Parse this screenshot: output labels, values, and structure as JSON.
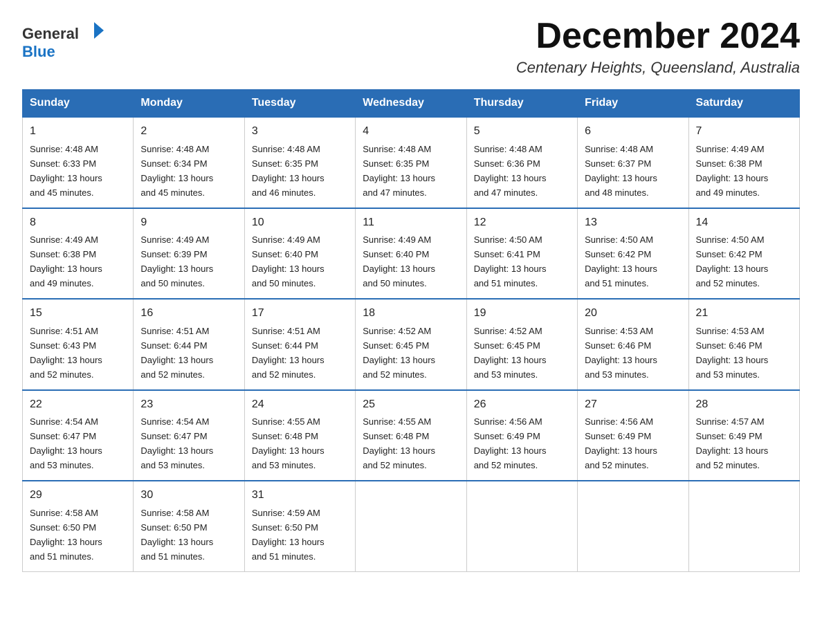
{
  "logo": {
    "text_general": "General",
    "text_blue": "Blue"
  },
  "title": "December 2024",
  "subtitle": "Centenary Heights, Queensland, Australia",
  "weekdays": [
    "Sunday",
    "Monday",
    "Tuesday",
    "Wednesday",
    "Thursday",
    "Friday",
    "Saturday"
  ],
  "weeks": [
    [
      {
        "day": "1",
        "sunrise": "4:48 AM",
        "sunset": "6:33 PM",
        "daylight": "13 hours and 45 minutes."
      },
      {
        "day": "2",
        "sunrise": "4:48 AM",
        "sunset": "6:34 PM",
        "daylight": "13 hours and 45 minutes."
      },
      {
        "day": "3",
        "sunrise": "4:48 AM",
        "sunset": "6:35 PM",
        "daylight": "13 hours and 46 minutes."
      },
      {
        "day": "4",
        "sunrise": "4:48 AM",
        "sunset": "6:35 PM",
        "daylight": "13 hours and 47 minutes."
      },
      {
        "day": "5",
        "sunrise": "4:48 AM",
        "sunset": "6:36 PM",
        "daylight": "13 hours and 47 minutes."
      },
      {
        "day": "6",
        "sunrise": "4:48 AM",
        "sunset": "6:37 PM",
        "daylight": "13 hours and 48 minutes."
      },
      {
        "day": "7",
        "sunrise": "4:49 AM",
        "sunset": "6:38 PM",
        "daylight": "13 hours and 49 minutes."
      }
    ],
    [
      {
        "day": "8",
        "sunrise": "4:49 AM",
        "sunset": "6:38 PM",
        "daylight": "13 hours and 49 minutes."
      },
      {
        "day": "9",
        "sunrise": "4:49 AM",
        "sunset": "6:39 PM",
        "daylight": "13 hours and 50 minutes."
      },
      {
        "day": "10",
        "sunrise": "4:49 AM",
        "sunset": "6:40 PM",
        "daylight": "13 hours and 50 minutes."
      },
      {
        "day": "11",
        "sunrise": "4:49 AM",
        "sunset": "6:40 PM",
        "daylight": "13 hours and 50 minutes."
      },
      {
        "day": "12",
        "sunrise": "4:50 AM",
        "sunset": "6:41 PM",
        "daylight": "13 hours and 51 minutes."
      },
      {
        "day": "13",
        "sunrise": "4:50 AM",
        "sunset": "6:42 PM",
        "daylight": "13 hours and 51 minutes."
      },
      {
        "day": "14",
        "sunrise": "4:50 AM",
        "sunset": "6:42 PM",
        "daylight": "13 hours and 52 minutes."
      }
    ],
    [
      {
        "day": "15",
        "sunrise": "4:51 AM",
        "sunset": "6:43 PM",
        "daylight": "13 hours and 52 minutes."
      },
      {
        "day": "16",
        "sunrise": "4:51 AM",
        "sunset": "6:44 PM",
        "daylight": "13 hours and 52 minutes."
      },
      {
        "day": "17",
        "sunrise": "4:51 AM",
        "sunset": "6:44 PM",
        "daylight": "13 hours and 52 minutes."
      },
      {
        "day": "18",
        "sunrise": "4:52 AM",
        "sunset": "6:45 PM",
        "daylight": "13 hours and 52 minutes."
      },
      {
        "day": "19",
        "sunrise": "4:52 AM",
        "sunset": "6:45 PM",
        "daylight": "13 hours and 53 minutes."
      },
      {
        "day": "20",
        "sunrise": "4:53 AM",
        "sunset": "6:46 PM",
        "daylight": "13 hours and 53 minutes."
      },
      {
        "day": "21",
        "sunrise": "4:53 AM",
        "sunset": "6:46 PM",
        "daylight": "13 hours and 53 minutes."
      }
    ],
    [
      {
        "day": "22",
        "sunrise": "4:54 AM",
        "sunset": "6:47 PM",
        "daylight": "13 hours and 53 minutes."
      },
      {
        "day": "23",
        "sunrise": "4:54 AM",
        "sunset": "6:47 PM",
        "daylight": "13 hours and 53 minutes."
      },
      {
        "day": "24",
        "sunrise": "4:55 AM",
        "sunset": "6:48 PM",
        "daylight": "13 hours and 53 minutes."
      },
      {
        "day": "25",
        "sunrise": "4:55 AM",
        "sunset": "6:48 PM",
        "daylight": "13 hours and 52 minutes."
      },
      {
        "day": "26",
        "sunrise": "4:56 AM",
        "sunset": "6:49 PM",
        "daylight": "13 hours and 52 minutes."
      },
      {
        "day": "27",
        "sunrise": "4:56 AM",
        "sunset": "6:49 PM",
        "daylight": "13 hours and 52 minutes."
      },
      {
        "day": "28",
        "sunrise": "4:57 AM",
        "sunset": "6:49 PM",
        "daylight": "13 hours and 52 minutes."
      }
    ],
    [
      {
        "day": "29",
        "sunrise": "4:58 AM",
        "sunset": "6:50 PM",
        "daylight": "13 hours and 51 minutes."
      },
      {
        "day": "30",
        "sunrise": "4:58 AM",
        "sunset": "6:50 PM",
        "daylight": "13 hours and 51 minutes."
      },
      {
        "day": "31",
        "sunrise": "4:59 AM",
        "sunset": "6:50 PM",
        "daylight": "13 hours and 51 minutes."
      },
      null,
      null,
      null,
      null
    ]
  ],
  "labels": {
    "sunrise": "Sunrise:",
    "sunset": "Sunset:",
    "daylight": "Daylight:"
  }
}
